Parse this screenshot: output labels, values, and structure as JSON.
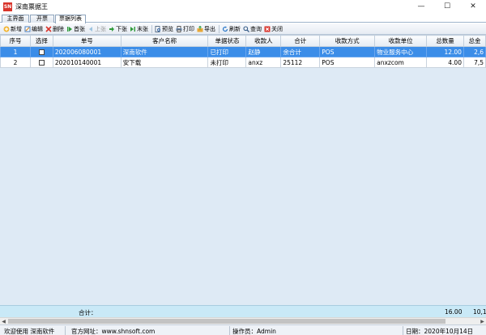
{
  "app": {
    "logo_text": "SN",
    "title": "深南票据王"
  },
  "window": {
    "minimize": "—",
    "maximize": "☐",
    "close": "✕"
  },
  "tabs": [
    {
      "label": "主界面"
    },
    {
      "label": "开票"
    },
    {
      "label": "票据列表"
    }
  ],
  "toolbar": [
    {
      "label": "新增",
      "icon": "add-icon"
    },
    {
      "label": "编辑",
      "icon": "edit-icon"
    },
    {
      "label": "删除",
      "icon": "delete-icon"
    },
    {
      "label": "首张",
      "icon": "first-icon"
    },
    {
      "label": "上张",
      "icon": "prev-icon"
    },
    {
      "label": "下张",
      "icon": "next-icon"
    },
    {
      "label": "末张",
      "icon": "last-icon"
    },
    {
      "label": "预览",
      "icon": "preview-icon"
    },
    {
      "label": "打印",
      "icon": "print-icon"
    },
    {
      "label": "导出",
      "icon": "export-icon"
    },
    {
      "label": "刷新",
      "icon": "refresh-icon"
    },
    {
      "label": "查询",
      "icon": "search-icon"
    },
    {
      "label": "关闭",
      "icon": "close-icon"
    }
  ],
  "table": {
    "headers": [
      "序号",
      "选择",
      "单号",
      "客户名称",
      "单据状态",
      "收款人",
      "合计",
      "收款方式",
      "收款单位",
      "总数量",
      "总金"
    ],
    "rows": [
      {
        "seq": "1",
        "no": "202006080001",
        "customer": "深南软件",
        "status": "已打印",
        "payee": "赵静",
        "total": "余合计",
        "method": "POS",
        "unit": "物业服务中心",
        "qty": "12.00",
        "amount": "2,6"
      },
      {
        "seq": "2",
        "no": "202010140001",
        "customer": "安下载",
        "status": "未打印",
        "payee": "anxz",
        "total": "25112",
        "method": "POS",
        "unit": "anxzcom",
        "qty": "4.00",
        "amount": "7,5"
      }
    ]
  },
  "totals": {
    "label": "合计：",
    "qty": "16.00",
    "amount": "10,1"
  },
  "status": {
    "welcome": "欢迎使用 深南软件",
    "website": "官方网址：www.shnsoft.com",
    "operator": "操作员：Admin",
    "date": "日期：2020年10月14日"
  }
}
